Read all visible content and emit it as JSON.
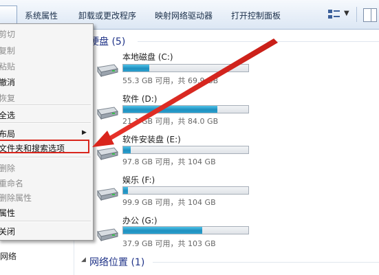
{
  "toolbar": {
    "items": [
      "系统属性",
      "卸载或更改程序",
      "映射网络驱动器",
      "打开控制面板"
    ]
  },
  "nav": {
    "network": "网络"
  },
  "content": {
    "hard_disks_header": "硬盘 (5)",
    "network_header": "网络位置 (1)",
    "drives": [
      {
        "name": "本地磁盘 (C:)",
        "info": "55.3 GB 可用，共 69.9 GB",
        "used_fraction": 0.21
      },
      {
        "name": "软件 (D:)",
        "info": "21.1 GB 可用，共 84.0 GB",
        "used_fraction": 0.75
      },
      {
        "name": "软件安装盘 (E:)",
        "info": "97.8 GB 可用，共 104 GB",
        "used_fraction": 0.06
      },
      {
        "name": "娱乐 (F:)",
        "info": "99.9 GB 可用，共 104 GB",
        "used_fraction": 0.04
      },
      {
        "name": "办公 (G:)",
        "info": "37.9 GB 可用，共 103 GB",
        "used_fraction": 0.63
      }
    ]
  },
  "menu": {
    "items": [
      "剪切",
      "复制",
      "粘贴",
      "撤消",
      "恢复",
      "全选",
      "布局",
      "文件夹和搜索选项",
      "删除",
      "重命名",
      "删除属性",
      "属性",
      "关闭"
    ]
  },
  "colors": {
    "highlight_border": "#d9251c",
    "arrow": "#d9251c",
    "bar_fill": "#26a0d0"
  }
}
